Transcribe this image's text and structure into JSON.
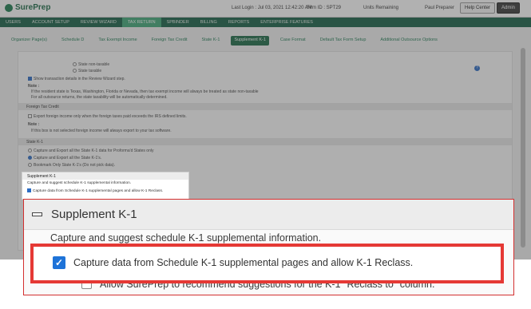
{
  "topbar": {
    "brand": "SurePrep",
    "login_text": "Last Login : Jul 03, 2021 12:42:20 AM",
    "firm_id": "Firm ID : SPT29",
    "units": "Units Remaining",
    "user": "Paul Preparer",
    "help": "Help Center",
    "role": "Admin"
  },
  "main_nav": [
    "USERS",
    "ACCOUNT SETUP",
    "REVIEW WIZARD",
    "TAX RETURN",
    "SPBINDER",
    "BILLING",
    "REPORTS",
    "ENTERPRISE FEATURES"
  ],
  "main_nav_active": "TAX RETURN",
  "sub_nav": [
    "Organizer Page(s)",
    "Schedule D",
    "Tax Exempt Income",
    "Foreign Tax Credit",
    "State K-1",
    "Supplement K-1",
    "Case Format",
    "Default Tax Form Setup",
    "Additional Outsource Options"
  ],
  "sub_nav_active": "Supplement K-1",
  "background": {
    "lines": [
      "State non-taxable",
      "State taxable",
      "Show transaction details in the Review Wizard step.",
      "Note :",
      "If the resident state is Texas, Washington, Florida or Nevada, then tax exempt income will always be treated as state non-taxable",
      "For all outsource returns, the state taxability will be automatically determined."
    ],
    "foreign_tax_head": "Foreign Tax Credit",
    "foreign_tax_lines": [
      "Export foreign income only when the foreign taxes paid exceeds the IRS defined limits.",
      "Note :",
      "If this box is not selected foreign income will always export to your tax software."
    ],
    "state_k1_head": "State K-1",
    "state_k1_lines": [
      "Capture and Export all the State K-1 data for Proforma'd States only",
      "Capture and Export all the State K-1's.",
      "Bookmark Only State K-1's (Do not pick data)."
    ],
    "help_glyph": "?"
  },
  "mini_panel": {
    "title": "Supplement K-1",
    "desc": "Capture and suggest schedule K-1 supplemental information.",
    "option": "Capture data from Schedule K-1 supplemental pages and allow K-1 Reclass."
  },
  "zoom_panel": {
    "title": "Supplement K-1",
    "description": "Capture and suggest schedule K-1 supplemental information.",
    "option_capture": "Capture data from Schedule K-1 supplemental pages and allow K-1 Reclass.",
    "option_capture_checked": true,
    "check_glyph": "✓",
    "option_allow": "Allow SurePrep to recommend suggestions for the K-1 \"Reclass to\" column."
  }
}
